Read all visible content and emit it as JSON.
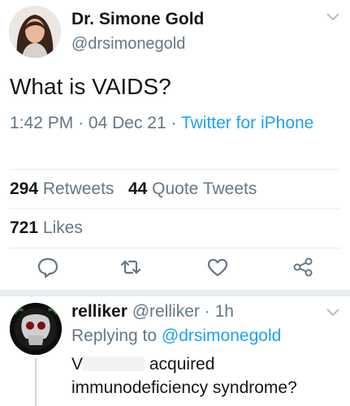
{
  "tweet": {
    "author_name": "Dr. Simone Gold",
    "author_handle": "@drsimonegold",
    "text": "What is VAIDS?",
    "time": "1:42 PM",
    "date": "04 Dec 21",
    "source": "Twitter for iPhone",
    "retweets_count": "294",
    "retweets_label": "Retweets",
    "quotes_count": "44",
    "quotes_label": "Quote Tweets",
    "likes_count": "721",
    "likes_label": "Likes"
  },
  "reply": {
    "author_name": "relliker",
    "author_handle": "@relliker",
    "age": "1h",
    "replying_prefix": "Replying to",
    "replying_to": "@drsimonegold",
    "text_start": "V",
    "text_middle": "acquired",
    "text_line2": "immunodeficiency syndrome?"
  },
  "icons": {
    "caret": "chevron-down-icon",
    "reply": "comment-icon",
    "retweet": "retweet-icon",
    "like": "heart-icon",
    "share": "share-icon"
  },
  "colors": {
    "accent": "#1da1f2",
    "secondary_text": "#657786",
    "icon_gray": "#657786",
    "divider": "#e6ecf0"
  }
}
